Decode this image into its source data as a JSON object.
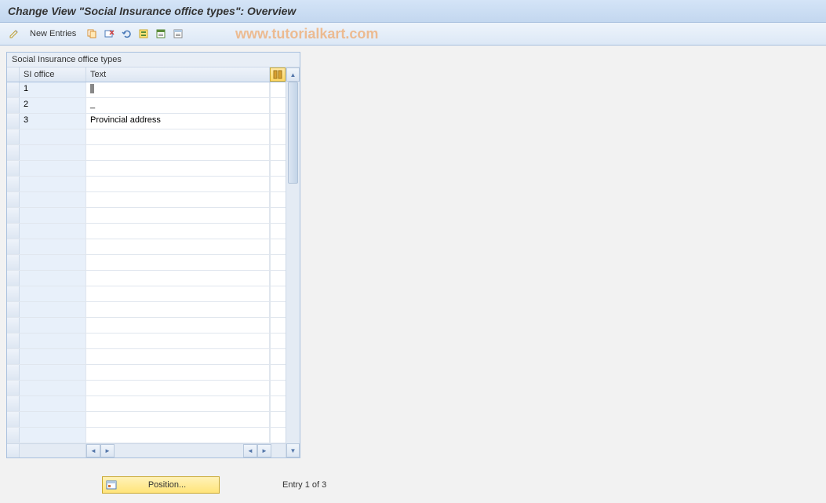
{
  "title": "Change View \"Social Insurance office types\": Overview",
  "toolbar": {
    "new_entries_label": "New Entries"
  },
  "watermark": "www.tutorialkart.com",
  "table": {
    "title": "Social Insurance office types",
    "columns": {
      "si_office": "SI office",
      "text": "Text"
    },
    "rows": [
      {
        "si_office": "1",
        "text": ""
      },
      {
        "si_office": "2",
        "text": "_"
      },
      {
        "si_office": "3",
        "text": "Provincial address"
      }
    ],
    "empty_row_count": 20
  },
  "footer": {
    "position_label": "Position...",
    "entry_status": "Entry 1 of 3"
  }
}
